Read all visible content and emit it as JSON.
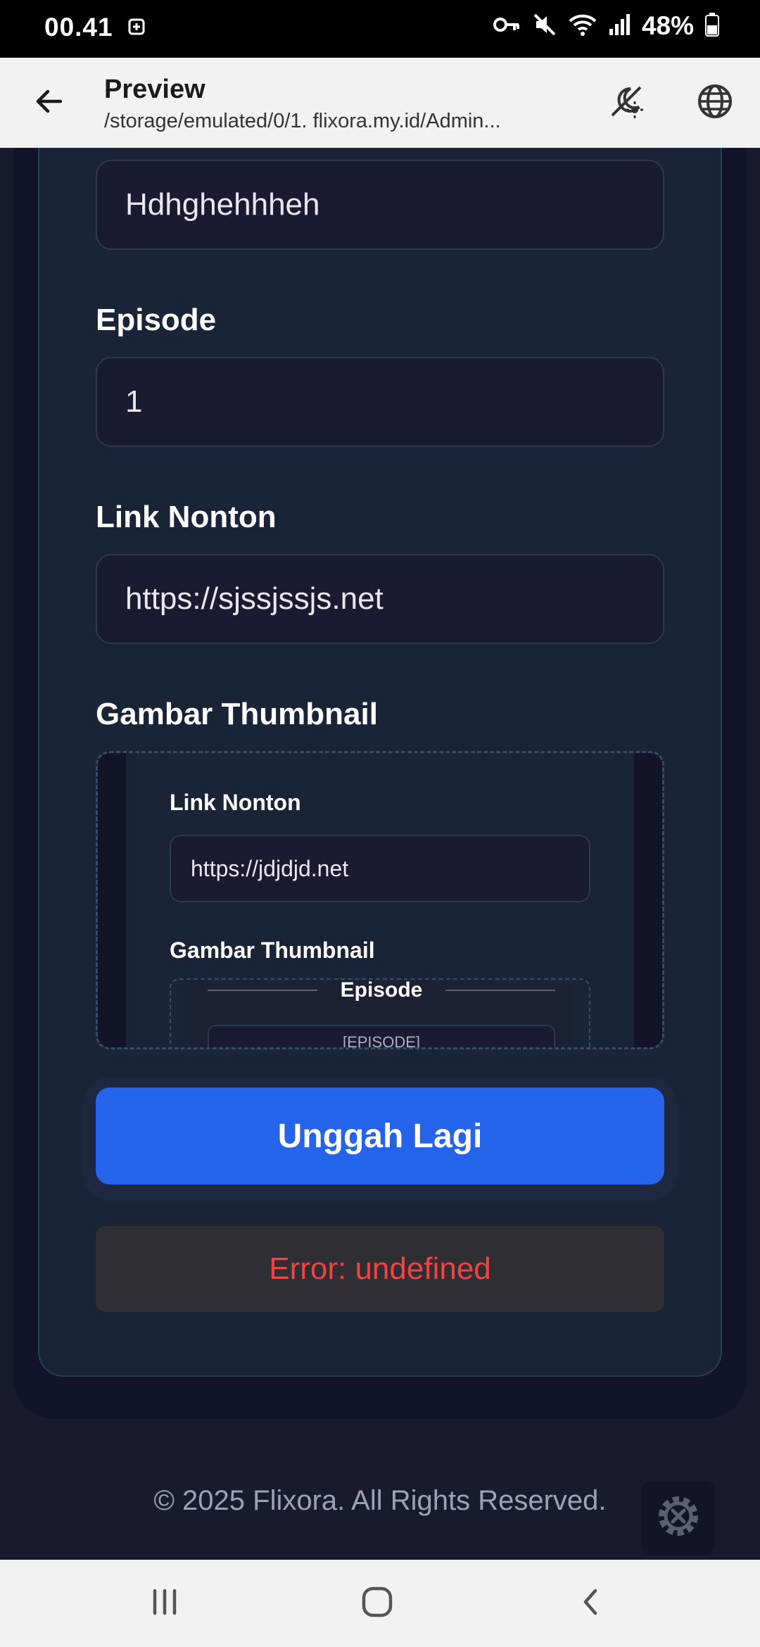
{
  "status_bar": {
    "time": "00.41",
    "battery": "48%",
    "icons": [
      "sync-icon",
      "key-icon",
      "mute-icon",
      "wifi-icon",
      "signal-icon",
      "battery-icon"
    ]
  },
  "app_bar": {
    "title": "Preview",
    "path": "/storage/emulated/0/1. flixora.my.id/Admin...",
    "icons": [
      "back-arrow-icon",
      "theme-toggle-icon",
      "globe-icon"
    ]
  },
  "form": {
    "title_value": "Hdhghehhheh",
    "episode_label": "Episode",
    "episode_value": "1",
    "link_label": "Link Nonton",
    "link_value": "https://sjssjssjs.net",
    "thumb_label": "Gambar Thumbnail"
  },
  "thumbnail_preview": {
    "link_label": "Link Nonton",
    "link_value": "https://jdjdjd.net",
    "thumb_label": "Gambar Thumbnail",
    "nested_episode_label": "Episode",
    "nested_placeholder": "[EPISODE]"
  },
  "actions": {
    "upload_again": "Unggah Lagi"
  },
  "error": {
    "message": "Error: undefined"
  },
  "footer": {
    "copyright": "© 2025 Flixora. All Rights Reserved."
  },
  "colors": {
    "primary": "#2563eb",
    "error": "#ef4444",
    "card": "#192437",
    "field": "#1a1a30",
    "background": "#191a2e"
  }
}
